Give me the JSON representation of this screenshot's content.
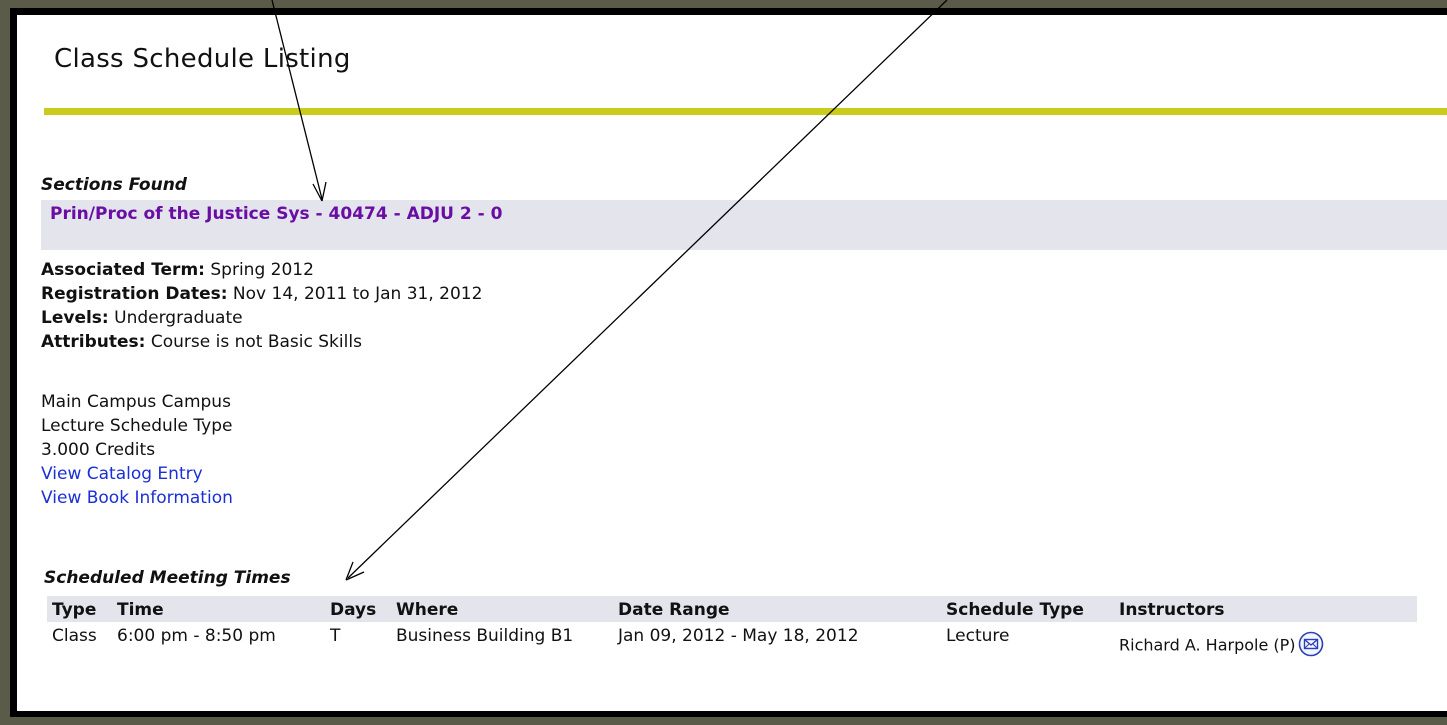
{
  "page": {
    "title": "Class Schedule Listing",
    "sections_found_label": "Sections Found",
    "rule_color": "#c9cc1a"
  },
  "section": {
    "heading": "Prin/Proc of the Justice Sys - 40474 - ADJU 2 - 0",
    "associated_term_label": "Associated Term:",
    "associated_term_value": " Spring 2012",
    "registration_dates_label": "Registration Dates:",
    "registration_dates_value": " Nov 14, 2011 to Jan 31, 2012",
    "levels_label": "Levels:",
    "levels_value": " Undergraduate",
    "attributes_label": "Attributes:",
    "attributes_value": " Course is not Basic Skills",
    "campus": "Main Campus Campus",
    "schedule_type": "Lecture Schedule Type",
    "credits": "3.000 Credits",
    "catalog_link": "View Catalog Entry",
    "book_link": "View Book Information"
  },
  "meetings": {
    "title": "Scheduled Meeting Times",
    "headers": {
      "type": "Type",
      "time": "Time",
      "days": "Days",
      "where": "Where",
      "date_range": "Date Range",
      "schedule_type": "Schedule Type",
      "instructors": "Instructors"
    },
    "rows": [
      {
        "type": "Class",
        "time": "6:00 pm - 8:50 pm",
        "days": "T",
        "where": "Business Building B1",
        "date_range": "Jan 09, 2012 - May 18, 2012",
        "schedule_type": "Lecture",
        "instructor": "Richard A. Harpole (P)"
      }
    ]
  },
  "icons": {
    "email": "email-icon"
  }
}
